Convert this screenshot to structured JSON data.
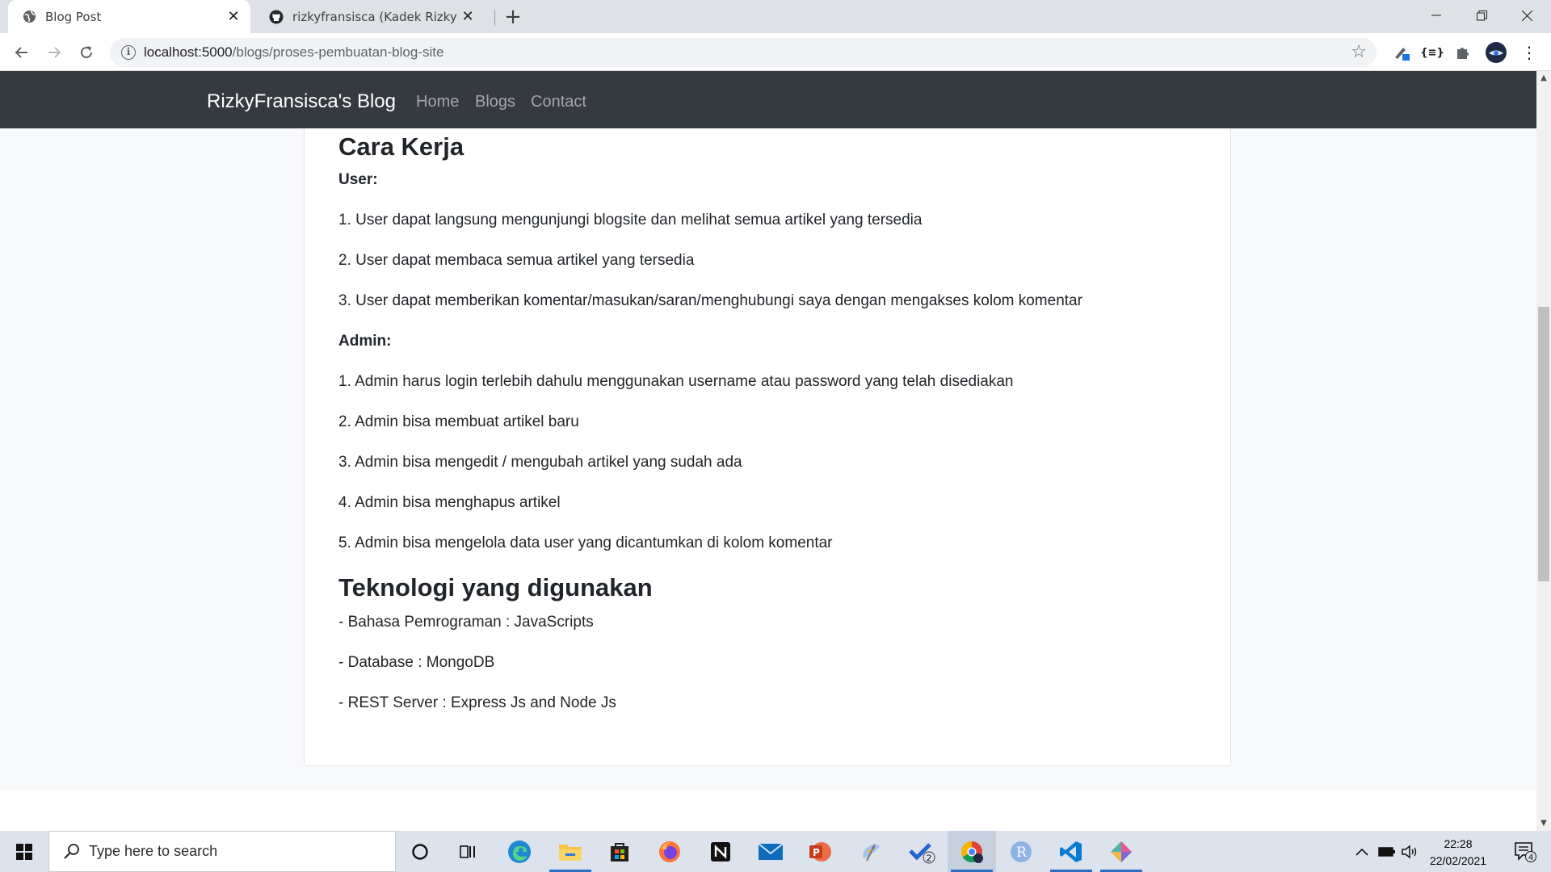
{
  "browser": {
    "tabs": [
      {
        "title": "Blog Post",
        "active": true
      },
      {
        "title": "rizkyfransisca (Kadek Rizky Fransisca)",
        "active": false
      }
    ],
    "url_host": "localhost:5000",
    "url_path": "/blogs/proses-pembuatan-blog-site",
    "new_tab_label": "+"
  },
  "site": {
    "brand": "RizkyFransisca's Blog",
    "nav": [
      "Home",
      "Blogs",
      "Contact"
    ]
  },
  "article": {
    "heading_cara_kerja": "Cara Kerja",
    "user_label": "User:",
    "user_items": [
      "1. User dapat langsung mengunjungi blogsite dan melihat semua artikel yang tersedia",
      "2. User dapat membaca semua artikel yang tersedia",
      "3. User dapat memberikan komentar/masukan/saran/menghubungi saya dengan mengakses kolom komentar"
    ],
    "admin_label": "Admin:",
    "admin_items": [
      "1. Admin harus login terlebih dahulu menggunakan username atau password yang telah disediakan",
      "2. Admin bisa membuat artikel baru",
      "3. Admin bisa mengedit / mengubah artikel yang sudah ada",
      "4. Admin bisa menghapus artikel",
      "5. Admin bisa mengelola data user yang dicantumkan di kolom komentar"
    ],
    "heading_teknologi": "Teknologi yang digunakan",
    "tech_items": [
      "- Bahasa Pemrograman : JavaScripts",
      "- Database : MongoDB",
      "- REST Server : Express Js and Node Js"
    ]
  },
  "taskbar": {
    "search_placeholder": "Type here to search",
    "time": "22:28",
    "date": "22/02/2021",
    "todo_badge": "2",
    "notification_count": "4"
  },
  "icons": {
    "tab_favicon_1": "globe-icon",
    "tab_favicon_2": "github-icon"
  }
}
